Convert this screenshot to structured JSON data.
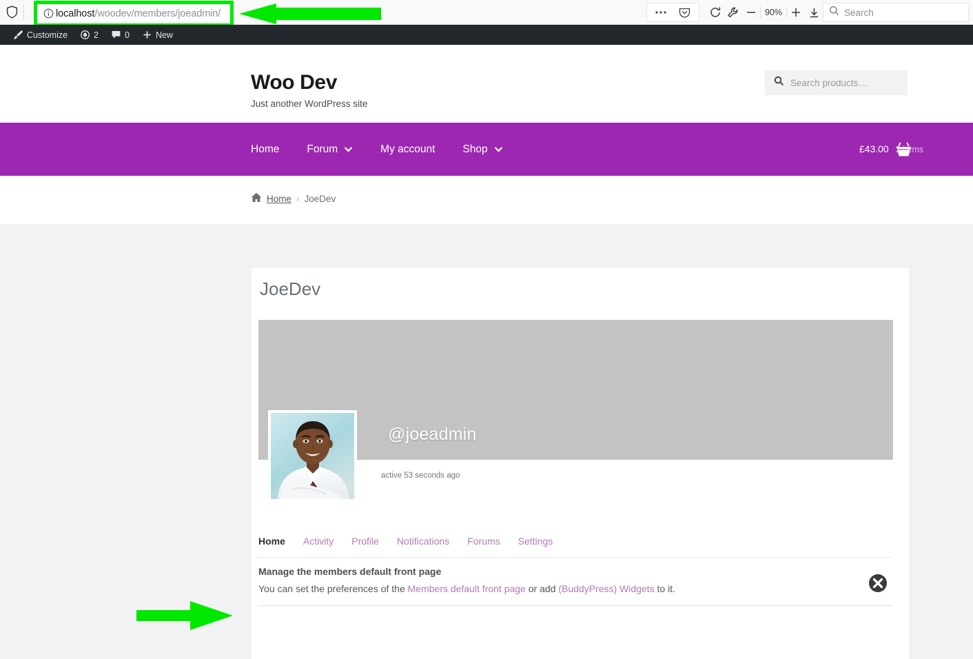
{
  "browser": {
    "shield_icon": "shield-icon",
    "identity_icon": "info-circle-icon",
    "url_host": "localhost",
    "url_path": "/woodev/members/joeadmin/",
    "url_full": "localhost/woodev/members/joeadmin/",
    "highlight_color": "#00e800",
    "menu_icon": "ellipsis-icon",
    "pocket_icon": "pocket-icon",
    "reload_icon": "reload-icon",
    "wrench_icon": "wrench-icon",
    "zoom_out_icon": "minus-icon",
    "zoom_level": "90%",
    "zoom_in_icon": "plus-icon",
    "downloads_icon": "download-icon",
    "search_icon": "search-icon",
    "search_placeholder": "Search"
  },
  "adminbar": {
    "background": "#23282d",
    "items": [
      {
        "icon": "paintbrush-icon",
        "label": "Customize"
      },
      {
        "icon": "updates-icon",
        "label": "2"
      },
      {
        "icon": "comment-icon",
        "label": "0"
      },
      {
        "icon": "plus-icon",
        "label": "New"
      }
    ]
  },
  "site": {
    "title": "Woo Dev",
    "description": "Just another WordPress site",
    "product_search": {
      "icon": "search-icon",
      "placeholder": "Search products…"
    }
  },
  "nav": {
    "accent": "#9c27b0",
    "links": [
      {
        "label": "Home",
        "has_caret": false
      },
      {
        "label": "Forum",
        "has_caret": true
      },
      {
        "label": "My account",
        "has_caret": false
      },
      {
        "label": "Shop",
        "has_caret": true
      }
    ],
    "cart": {
      "total": "£43.00",
      "count": "2 items",
      "icon": "shopping-basket-icon"
    }
  },
  "breadcrumb": {
    "home_icon": "home-icon",
    "home_label": "Home",
    "separator": "›",
    "current": "JoeDev"
  },
  "member": {
    "display_name": "JoeDev",
    "handle": "@joeadmin",
    "last_active": "active 53 seconds ago",
    "avatar_alt": "joeadmin-avatar",
    "tabs": [
      {
        "label": "Home",
        "current": true
      },
      {
        "label": "Activity",
        "current": false
      },
      {
        "label": "Profile",
        "current": false
      },
      {
        "label": "Notifications",
        "current": false
      },
      {
        "label": "Forums",
        "current": false
      },
      {
        "label": "Settings",
        "current": false
      }
    ]
  },
  "notice": {
    "title": "Manage the members default front page",
    "text_before": "You can set the preferences of the ",
    "link1": "Members default front page",
    "text_middle": " or add ",
    "link2": "(BuddyPress) Widgets",
    "text_after": " to it.",
    "dismiss_icon": "close-circle-icon"
  },
  "annotations": {
    "arrow_color": "#00e800",
    "arrow_urlbar": "arrow-pointing-to-urlbar",
    "arrow_profile": "arrow-pointing-to-profile"
  }
}
